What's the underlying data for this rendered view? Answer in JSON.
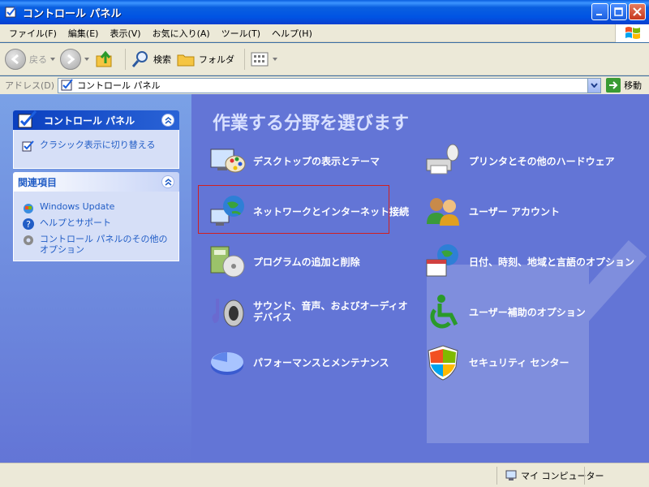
{
  "window": {
    "title": "コントロール パネル"
  },
  "menu": [
    "ファイル(F)",
    "編集(E)",
    "表示(V)",
    "お気に入り(A)",
    "ツール(T)",
    "ヘルプ(H)"
  ],
  "toolbar": {
    "back_label": "戻る",
    "search_label": "検索",
    "folder_label": "フォルダ"
  },
  "address": {
    "label": "アドレス(D)",
    "value": "コントロール パネル",
    "go_label": "移動"
  },
  "sidebar": {
    "panel_title": "コントロール パネル",
    "switch_link": "クラシック表示に切り替える",
    "related_title": "関連項目",
    "related_links": [
      "Windows Update",
      "ヘルプとサポート",
      "コントロール パネルのその他のオプション"
    ]
  },
  "main": {
    "heading": "作業する分野を選びます",
    "categories": [
      "デスクトップの表示とテーマ",
      "プリンタとその他のハードウェア",
      "ネットワークとインターネット接続",
      "ユーザー アカウント",
      "プログラムの追加と削除",
      "日付、時刻、地域と言語のオプション",
      "サウンド、音声、およびオーディオ デバイス",
      "ユーザー補助のオプション",
      "パフォーマンスとメンテナンス",
      "セキュリティ センター"
    ]
  },
  "status": {
    "zone": "マイ コンピューター"
  }
}
